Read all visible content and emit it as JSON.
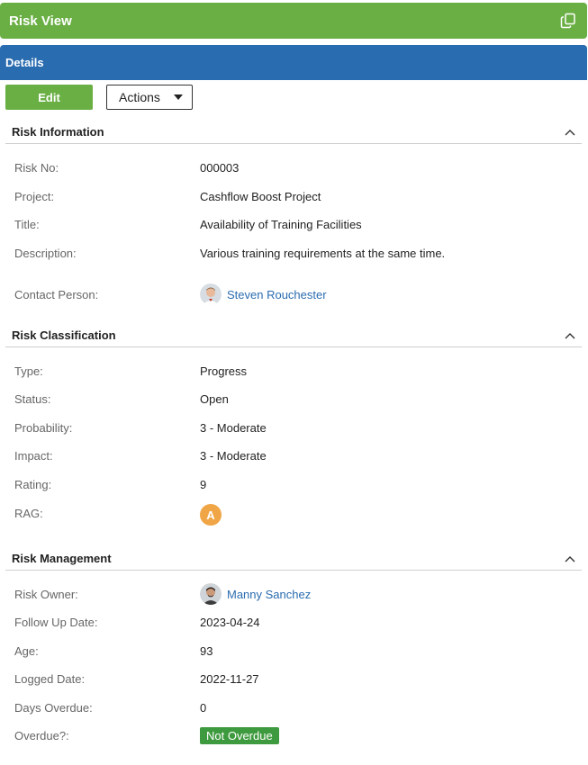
{
  "window": {
    "title": "Risk View"
  },
  "details_bar": {
    "label": "Details"
  },
  "toolbar": {
    "edit_label": "Edit",
    "actions_label": "Actions"
  },
  "sections": {
    "info": {
      "title": "Risk Information",
      "risk_no_label": "Risk No:",
      "risk_no": "000003",
      "project_label": "Project:",
      "project": "Cashflow Boost Project",
      "title_label": "Title:",
      "title_value": "Availability of Training Facilities",
      "description_label": "Description:",
      "description": "Various training requirements at the same time.",
      "contact_label": "Contact Person:",
      "contact": "Steven Rouchester"
    },
    "classification": {
      "title": "Risk Classification",
      "type_label": "Type:",
      "type": "Progress",
      "status_label": "Status:",
      "status": "Open",
      "probability_label": "Probability:",
      "probability": "3 - Moderate",
      "impact_label": "Impact:",
      "impact": "3 - Moderate",
      "rating_label": "Rating:",
      "rating": "9",
      "rag_label": "RAG:",
      "rag": "A"
    },
    "management": {
      "title": "Risk Management",
      "owner_label": "Risk Owner:",
      "owner": "Manny Sanchez",
      "follow_up_label": "Follow Up Date:",
      "follow_up": "2023-04-24",
      "age_label": "Age:",
      "age": "93",
      "logged_label": "Logged Date:",
      "logged": "2022-11-27",
      "days_overdue_label": "Days Overdue:",
      "days_overdue": "0",
      "overdue_label": "Overdue?:",
      "overdue": "Not Overdue"
    }
  },
  "colors": {
    "title_bar": "#6aaf44",
    "details_bar": "#2a6cb0",
    "link": "#2a6cb0",
    "rag_amber": "#f0a646",
    "overdue_badge": "#3e9a3e"
  },
  "icons": {
    "copy": "copy-icon",
    "collapse": "chevron-up-icon",
    "dropdown": "caret-down-icon"
  }
}
